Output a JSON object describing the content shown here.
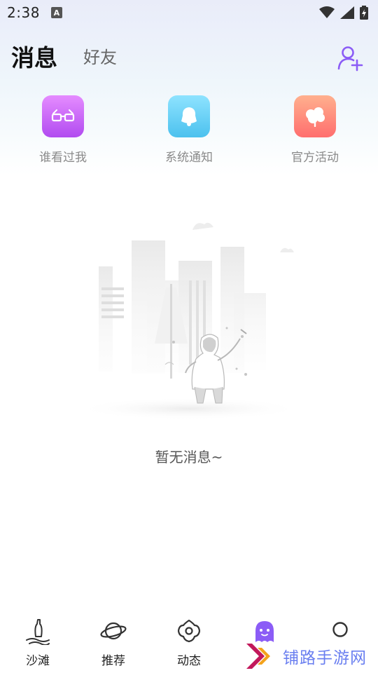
{
  "status_bar": {
    "time": "2:38",
    "notification_badge": "A"
  },
  "header": {
    "tabs": [
      {
        "label": "消息",
        "active": true
      },
      {
        "label": "好友",
        "active": false
      }
    ],
    "add_friend_icon": "person-add-icon"
  },
  "quick_entries": [
    {
      "label": "谁看过我",
      "icon": "glasses-icon",
      "color_from": "#e58cff",
      "color_to": "#b14bf0"
    },
    {
      "label": "系统通知",
      "icon": "bell-icon",
      "color_from": "#8ee3ff",
      "color_to": "#4cc1ee"
    },
    {
      "label": "官方活动",
      "icon": "flower-icon",
      "color_from": "#ffb08e",
      "color_to": "#ff6e6e"
    }
  ],
  "empty_state": {
    "text": "暂无消息~",
    "illustration": "empty-city-illustration"
  },
  "bottom_nav": {
    "items": [
      {
        "label": "沙滩",
        "icon": "bottle-beach-icon"
      },
      {
        "label": "推荐",
        "icon": "planet-icon"
      },
      {
        "label": "动态",
        "icon": "flower-outline-icon"
      },
      {
        "label": "",
        "icon": "ghost-message-icon",
        "active": true
      },
      {
        "label": "",
        "icon": "profile-circle-icon"
      }
    ]
  },
  "watermark": {
    "text": "铺路手游网"
  },
  "colors": {
    "accent": "#8b5cf6",
    "watermark": "#6a7ff0"
  }
}
